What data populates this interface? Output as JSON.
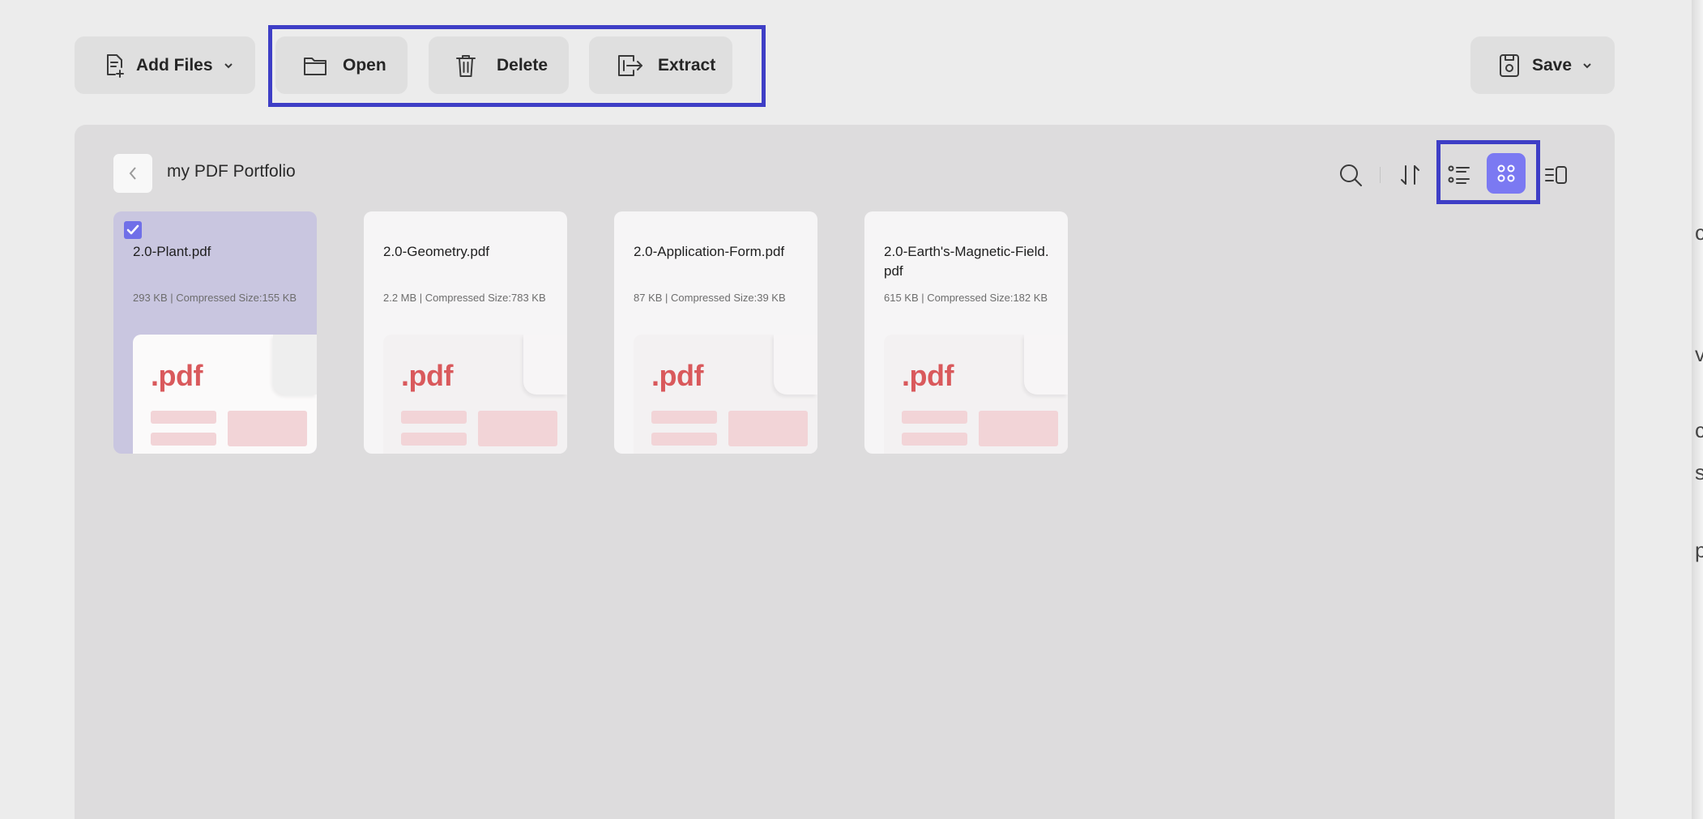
{
  "toolbar": {
    "add_files_label": "Add Files",
    "open_label": "Open",
    "delete_label": "Delete",
    "extract_label": "Extract",
    "save_label": "Save"
  },
  "portfolio": {
    "title": "my PDF Portfolio",
    "view_mode": "grid"
  },
  "files": [
    {
      "name": "2.0-Plant.pdf",
      "size": "293 KB | Compressed Size:155 KB",
      "selected": true,
      "thumb_ext": ".pdf"
    },
    {
      "name": "2.0-Geometry.pdf",
      "size": "2.2 MB | Compressed Size:783 KB",
      "selected": false,
      "thumb_ext": ".pdf"
    },
    {
      "name": "2.0-Application-Form.pdf",
      "size": "87 KB | Compressed Size:39 KB",
      "selected": false,
      "thumb_ext": ".pdf"
    },
    {
      "name": "2.0-Earth's-Magnetic-Field.pdf",
      "size": "615 KB | Compressed Size:182 KB",
      "selected": false,
      "thumb_ext": ".pdf"
    }
  ],
  "colors": {
    "accent": "#7b79f2",
    "highlight_box": "#3e3ec6",
    "pdf_red": "#d9595c",
    "selected_card": "#c9c6e0"
  },
  "edge_glyphs": [
    "c",
    "v",
    "c",
    "s",
    "p"
  ]
}
